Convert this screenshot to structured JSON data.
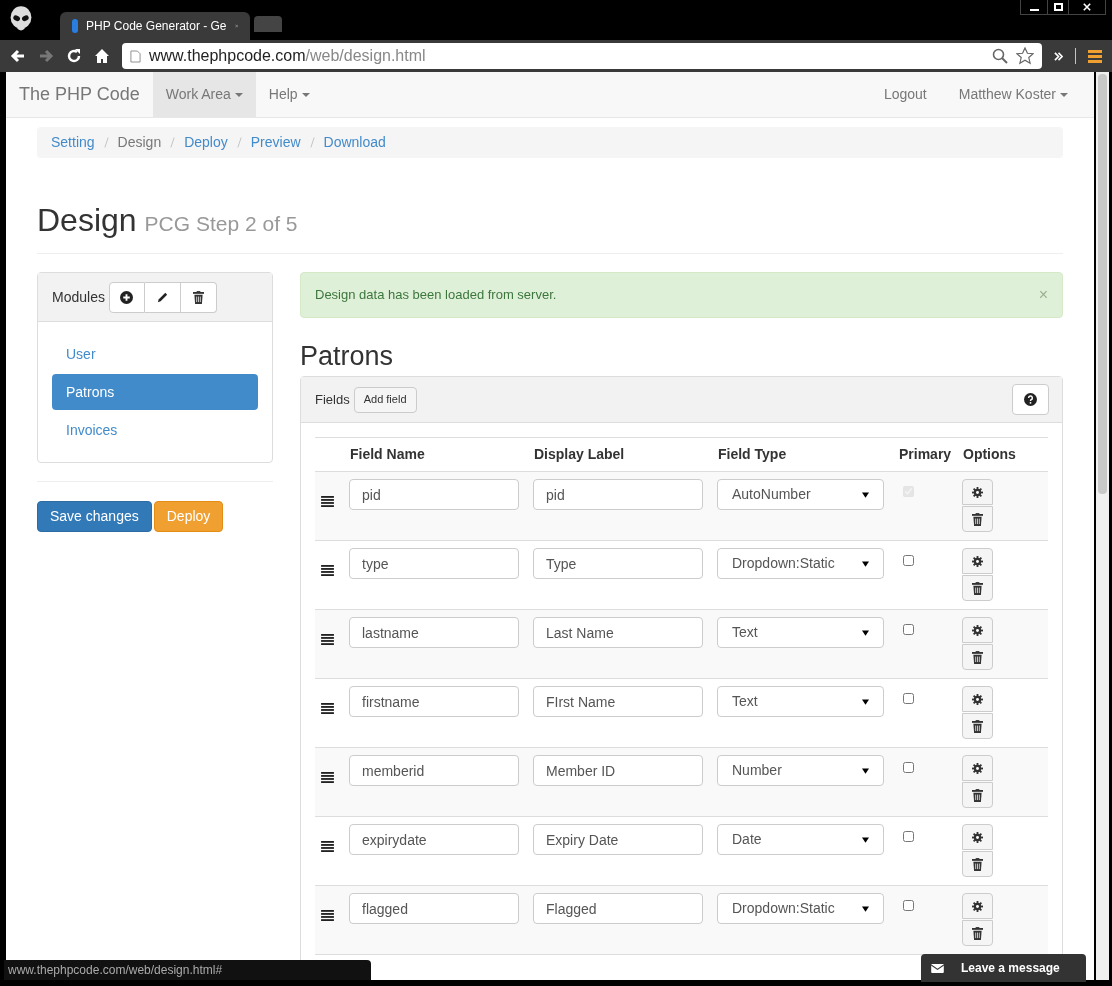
{
  "browser": {
    "tabs": [
      {
        "title": "PHP Code Generator - Ge",
        "selected": true
      }
    ],
    "url_host": "www.thephpcode.com",
    "url_path": "/web/design.html",
    "status_url": "www.thephpcode.com/web/design.html#"
  },
  "navbar": {
    "brand": "The PHP Code",
    "menus": [
      {
        "label": "Work Area",
        "selected": true
      },
      {
        "label": "Help",
        "selected": false
      }
    ],
    "right": [
      {
        "label": "Logout",
        "dropdown": false
      },
      {
        "label": "Matthew Koster",
        "dropdown": true
      }
    ]
  },
  "breadcrumb": [
    {
      "label": "Setting",
      "selected": false
    },
    {
      "label": "Design",
      "selected": true
    },
    {
      "label": "Deploy",
      "selected": false
    },
    {
      "label": "Preview",
      "selected": false
    },
    {
      "label": "Download",
      "selected": false
    }
  ],
  "heading": {
    "title": "Design",
    "subtitle": "PCG Step 2 of 5"
  },
  "modules": {
    "title": "Modules",
    "items": [
      {
        "label": "User",
        "selected": false
      },
      {
        "label": "Patrons",
        "selected": true
      },
      {
        "label": "Invoices",
        "selected": false
      }
    ]
  },
  "actions": [
    {
      "label": "Save changes",
      "kind": "primary"
    },
    {
      "label": "Deploy",
      "kind": "warning"
    }
  ],
  "alert": {
    "message": "Design data has been loaded from server.",
    "close": "×"
  },
  "module_title": "Patrons",
  "fields_panel": {
    "title": "Fields",
    "add_button": "Add field"
  },
  "table": {
    "columns": [
      "Field Name",
      "Display Label",
      "Field Type",
      "Primary",
      "Options"
    ],
    "rows": [
      {
        "field_name": "pid",
        "display_label": "pid",
        "field_type": "AutoNumber",
        "primary": true,
        "primary_disabled": true
      },
      {
        "field_name": "type",
        "display_label": "Type",
        "field_type": "Dropdown:Static",
        "primary": false,
        "primary_disabled": false
      },
      {
        "field_name": "lastname",
        "display_label": "Last Name",
        "field_type": "Text",
        "primary": false,
        "primary_disabled": false
      },
      {
        "field_name": "firstname",
        "display_label": "FIrst Name",
        "field_type": "Text",
        "primary": false,
        "primary_disabled": false
      },
      {
        "field_name": "memberid",
        "display_label": "Member ID",
        "field_type": "Number",
        "primary": false,
        "primary_disabled": false
      },
      {
        "field_name": "expirydate",
        "display_label": "Expiry Date",
        "field_type": "Date",
        "primary": false,
        "primary_disabled": false
      },
      {
        "field_name": "flagged",
        "display_label": "Flagged",
        "field_type": "Dropdown:Static",
        "primary": false,
        "primary_disabled": false
      }
    ]
  },
  "chat": {
    "label": "Leave a message"
  }
}
